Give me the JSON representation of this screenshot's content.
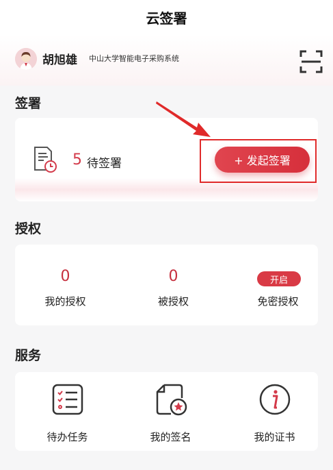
{
  "header": {
    "title": "云签署"
  },
  "profile": {
    "name": "胡旭雄",
    "organization": "中山大学智能电子采购系统"
  },
  "signing": {
    "section_title": "签署",
    "pending_count": "5",
    "pending_label": "待签署",
    "initiate_label": "+ 发起签署"
  },
  "authorization": {
    "section_title": "授权",
    "items": [
      {
        "value": "0",
        "label": "我的授权"
      },
      {
        "value": "0",
        "label": "被授权"
      },
      {
        "badge": "开启",
        "label": "免密授权"
      }
    ]
  },
  "services": {
    "section_title": "服务",
    "items": [
      {
        "label": "待办任务",
        "icon": "task-list-icon"
      },
      {
        "label": "我的签名",
        "icon": "signature-icon"
      },
      {
        "label": "我的证书",
        "icon": "certificate-info-icon"
      }
    ]
  },
  "colors": {
    "accent": "#d62f3b",
    "annotation": "#e02a2a"
  }
}
